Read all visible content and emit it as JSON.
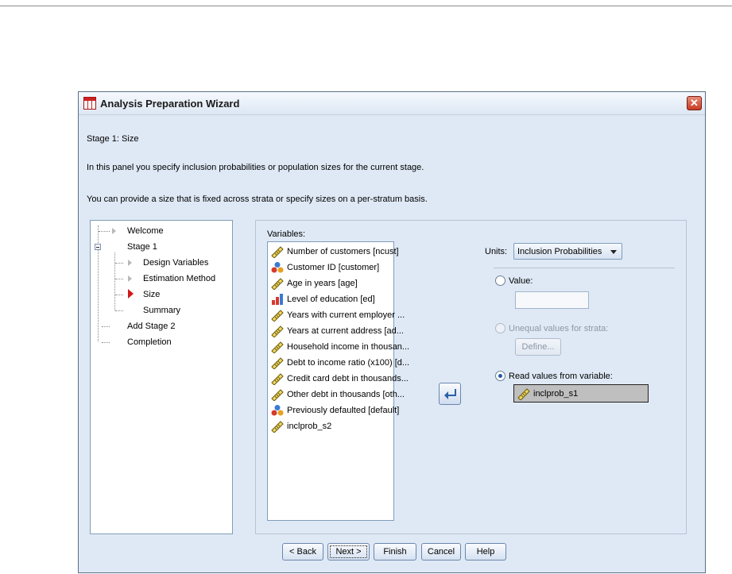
{
  "window": {
    "title": "Analysis Preparation Wizard",
    "close_label": "✕"
  },
  "header": {
    "stage_title": "Stage 1: Size",
    "description": "In this panel you specify inclusion probabilities or population sizes for the current stage.",
    "description2": "You can provide a size that is fixed across strata or specify sizes on a per-stratum basis."
  },
  "tree": {
    "items": [
      {
        "label": "Welcome"
      },
      {
        "label": "Stage 1"
      },
      {
        "label": "Design Variables"
      },
      {
        "label": "Estimation Method"
      },
      {
        "label": "Size"
      },
      {
        "label": "Summary"
      },
      {
        "label": "Add Stage 2"
      },
      {
        "label": "Completion"
      }
    ]
  },
  "variables": {
    "label": "Variables:",
    "items": [
      {
        "label": "Number of customers [ncust]",
        "icon": "scale-ruler-icon"
      },
      {
        "label": "Customer ID [customer]",
        "icon": "nominal-icon"
      },
      {
        "label": "Age in years [age]",
        "icon": "scale-ruler-icon"
      },
      {
        "label": "Level of education [ed]",
        "icon": "ordinal-icon"
      },
      {
        "label": "Years with current employer ...",
        "icon": "scale-ruler-icon"
      },
      {
        "label": "Years at current address [ad...",
        "icon": "scale-ruler-icon"
      },
      {
        "label": "Household income in thousan...",
        "icon": "scale-ruler-icon"
      },
      {
        "label": "Debt to income ratio (x100) [d...",
        "icon": "scale-ruler-icon"
      },
      {
        "label": "Credit card debt in thousands...",
        "icon": "scale-ruler-icon"
      },
      {
        "label": "Other debt in thousands [oth...",
        "icon": "scale-ruler-icon"
      },
      {
        "label": "Previously defaulted [default]",
        "icon": "nominal-icon"
      },
      {
        "label": "inclprob_s2",
        "icon": "scale-ruler-icon"
      }
    ]
  },
  "units": {
    "label": "Units:",
    "value": "Inclusion Probabilities"
  },
  "options": {
    "value_label": "Value:",
    "unequal_label": "Unequal values for strata:",
    "define_label": "Define...",
    "read_label": "Read values from variable:",
    "selected_variable": "inclprob_s1"
  },
  "footer": {
    "back": "< Back",
    "next": "Next >",
    "finish": "Finish",
    "cancel": "Cancel",
    "help": "Help"
  }
}
